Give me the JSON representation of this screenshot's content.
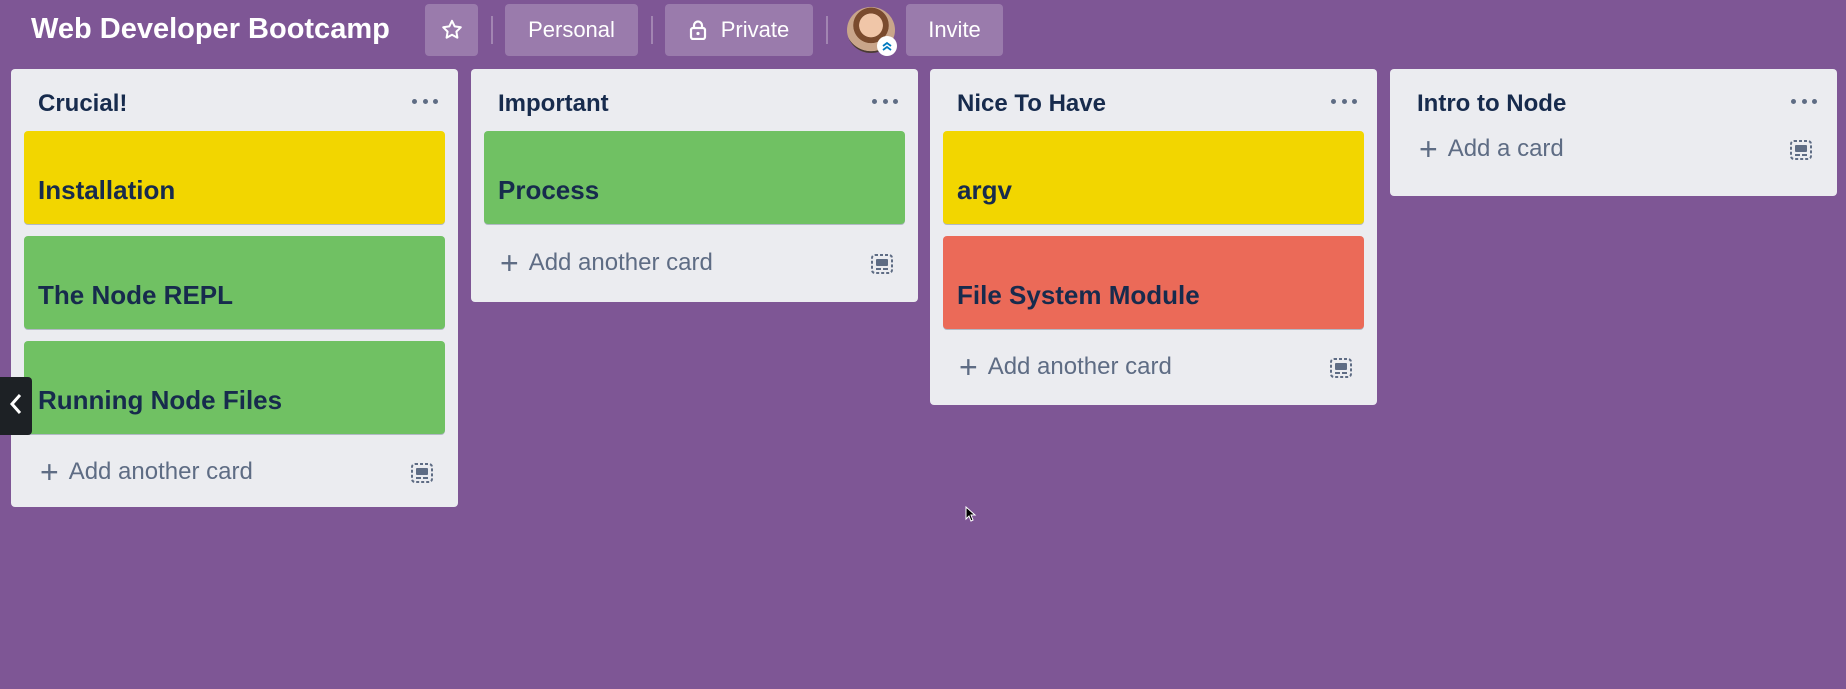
{
  "header": {
    "board_title": "Web Developer Bootcamp",
    "star_icon": "star-icon",
    "workspace_label": "Personal",
    "visibility_label": "Private",
    "visibility_icon": "lock-icon",
    "invite_label": "Invite"
  },
  "lists": [
    {
      "title": "Crucial!",
      "cards": [
        {
          "title": "Installation",
          "color": "#f2d600"
        },
        {
          "title": "The Node REPL",
          "color": "#70c163"
        },
        {
          "title": "Running Node Files",
          "color": "#70c163"
        }
      ],
      "add_label": "Add another card"
    },
    {
      "title": "Important",
      "cards": [
        {
          "title": "Process",
          "color": "#70c163"
        }
      ],
      "add_label": "Add another card"
    },
    {
      "title": "Nice To Have",
      "cards": [
        {
          "title": "argv",
          "color": "#f2d600"
        },
        {
          "title": "File System Module",
          "color": "#eb6a58"
        }
      ],
      "add_label": "Add another card"
    },
    {
      "title": "Intro to Node",
      "cards": [],
      "add_label": "Add a card"
    }
  ],
  "colors": {
    "board_background": "#7e5695",
    "list_background": "#ebecf0",
    "label_yellow": "#f2d600",
    "label_green": "#70c163",
    "label_red": "#eb6a58"
  }
}
